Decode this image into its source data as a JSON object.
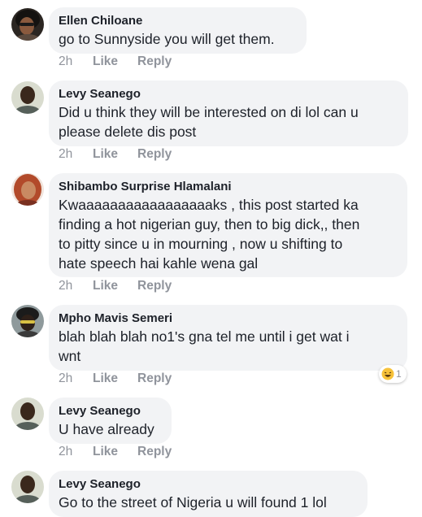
{
  "comments": [
    {
      "author": "Ellen Chiloane",
      "lines": [
        "go to Sunnyside you will get them."
      ],
      "time": "2h",
      "like_label": "Like",
      "reply_label": "Reply"
    },
    {
      "author": "Levy Seanego",
      "lines": [
        "Did u think they will be interested on di lol can u",
        "please delete dis post"
      ],
      "time": "2h",
      "like_label": "Like",
      "reply_label": "Reply"
    },
    {
      "author": "Shibambo Surprise Hlamalani",
      "lines": [
        "Kwaaaaaaaaaaaaaaaaaks , this post started ka",
        "finding a hot nigerian guy, then to big dick,, then",
        "to pitty since u in mourning , now u shifting to",
        "hate speech hai kahle wena gal"
      ],
      "time": "2h",
      "like_label": "Like",
      "reply_label": "Reply"
    },
    {
      "author": "Mpho Mavis Semeri",
      "lines": [
        "blah blah blah no1's gna tel me until i get wat i",
        "wnt"
      ],
      "time": "2h",
      "like_label": "Like",
      "reply_label": "Reply",
      "reaction": {
        "icon": "laughing-emoji-icon",
        "count": "1"
      }
    },
    {
      "author": "Levy Seanego",
      "lines": [
        "U have already"
      ],
      "time": "2h",
      "like_label": "Like",
      "reply_label": "Reply"
    },
    {
      "author": "Levy Seanego",
      "lines": [
        "Go to the street of Nigeria u will found 1 lol"
      ]
    }
  ],
  "colors": {
    "bubble": "#f2f3f5",
    "text": "#1d2129",
    "meta": "#90949c"
  }
}
